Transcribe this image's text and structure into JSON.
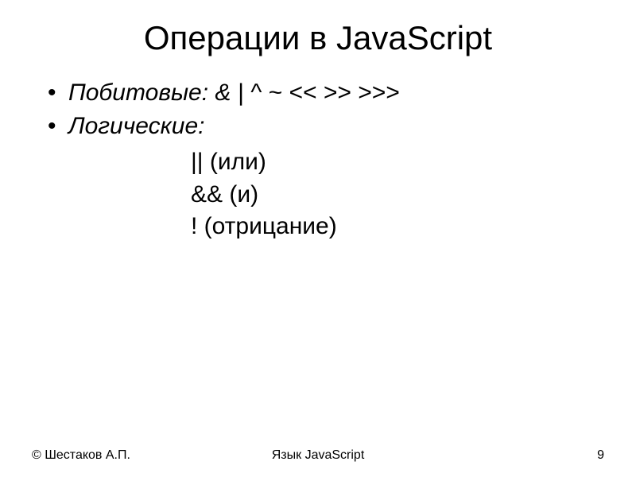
{
  "title": "Операции в JavaScript",
  "bullet1": "Побитовые:   &   |   ^   ~   <<   >>   >>>",
  "bullet2": "Логические:",
  "sub1": "|| (или)",
  "sub2": "&& (и)",
  "sub3": "! (отрицание)",
  "footer": {
    "left": "© Шестаков А.П.",
    "center": "Язык JavaScript",
    "right": "9"
  }
}
